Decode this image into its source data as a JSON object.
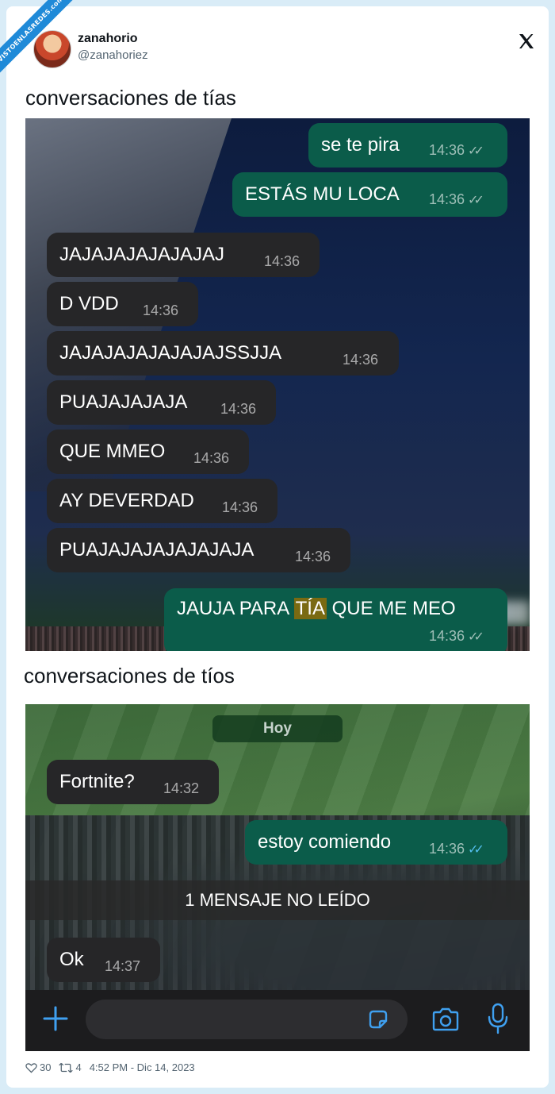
{
  "watermark": "VISTOENLASREDES.com",
  "tweet": {
    "username": "zanahorio",
    "handle": "@zanahoriez",
    "caption_girls": "conversaciones de tías",
    "caption_guys": "conversaciones de tíos",
    "likes": "30",
    "retweets": "4",
    "timestamp": "4:52 PM - Dic 14, 2023"
  },
  "chat_girls": {
    "messages": [
      {
        "dir": "out",
        "text": "se te pira",
        "time": "14:36"
      },
      {
        "dir": "out",
        "text": "ESTÁS MU LOCA",
        "time": "14:36"
      },
      {
        "dir": "in",
        "text": "JAJAJAJAJAJAJAJ",
        "time": "14:36"
      },
      {
        "dir": "in",
        "text": "D VDD",
        "time": "14:36"
      },
      {
        "dir": "in",
        "text": "JAJAJAJAJAJAJAJSSJJA",
        "time": "14:36"
      },
      {
        "dir": "in",
        "text": "PUAJAJAJAJA",
        "time": "14:36"
      },
      {
        "dir": "in",
        "text": "QUE MMEO",
        "time": "14:36"
      },
      {
        "dir": "in",
        "text": "AY DEVERDAD",
        "time": "14:36"
      },
      {
        "dir": "in",
        "text": "PUAJAJAJAJAJAJAJA",
        "time": "14:36"
      }
    ],
    "last": {
      "pre": "JAUJA PARA ",
      "highlight": "TÍA",
      "post": " QUE ME MEO",
      "time": "14:36"
    }
  },
  "chat_guys": {
    "day_label": "Hoy",
    "messages": [
      {
        "dir": "in",
        "text": "Fortnite?",
        "time": "14:32"
      },
      {
        "dir": "out",
        "text": "estoy comiendo",
        "time": "14:36"
      }
    ],
    "unread_label": "1 MENSAJE NO LEÍDO",
    "after_unread": {
      "dir": "in",
      "text": "Ok",
      "time": "14:37"
    }
  },
  "icons": [
    "x-logo-icon",
    "plus-icon",
    "sticker-icon",
    "camera-icon",
    "mic-icon",
    "heart-icon",
    "retweet-icon"
  ],
  "colors": {
    "incoming_bubble": "#262628",
    "outgoing_bubble": "#0b5c4a",
    "read_ticks": "#53bdeb"
  }
}
